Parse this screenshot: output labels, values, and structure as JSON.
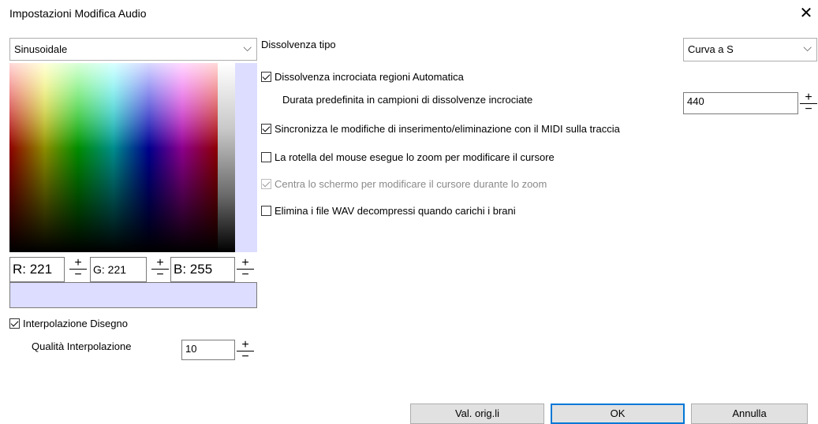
{
  "dialog": {
    "title": "Impostazioni Modifica Audio",
    "close_glyph": "✕"
  },
  "left": {
    "wave_select": {
      "value": "Sinusoidale"
    },
    "color_picker": {
      "r_label": "R: 221",
      "g_label": "G: 221",
      "b_label": "B: 255",
      "current_color": "#ddddff"
    },
    "interp_checkbox": {
      "label": "Interpolazione Disegno",
      "checked": true
    },
    "quality_label": "Qualità Interpolazione",
    "quality_value": "10"
  },
  "right": {
    "fade_type_label": "Dissolvenza tipo",
    "fade_type_value": "Curva a S",
    "auto_crossfade": {
      "label": "Dissolvenza incrociata regioni Automatica",
      "checked": true
    },
    "crossfade_len_label": "Durata predefinita in campioni di dissolvenze incrociate",
    "crossfade_len_value": "440",
    "sync_midi": {
      "label": "Sincronizza le modifiche di inserimento/eliminazione con il MIDI sulla traccia",
      "checked": true
    },
    "wheel_zoom": {
      "label": "La rotella del mouse esegue lo zoom per modificare il cursore",
      "checked": false
    },
    "center_screen": {
      "label": "Centra lo schermo per modificare il cursore durante lo zoom",
      "checked": true,
      "disabled": true
    },
    "delete_wav": {
      "label": "Elimina i file WAV decompressi quando carichi i brani",
      "checked": false
    }
  },
  "spinner": {
    "plus": "+",
    "minus": "−"
  },
  "buttons": {
    "defaults": "Val. orig.li",
    "ok": "OK",
    "cancel": "Annulla"
  }
}
